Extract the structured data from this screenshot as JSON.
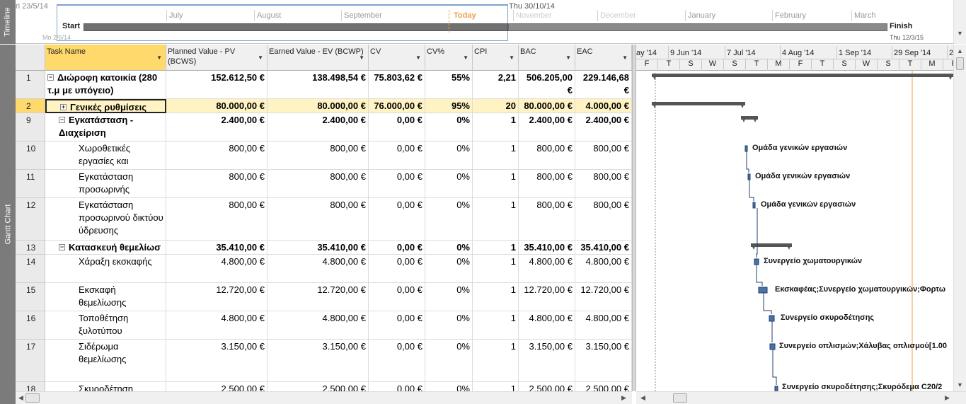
{
  "timeline": {
    "side_label": "Timeline",
    "start_date_top": "ri 23/5/14",
    "start_date_bottom": "Mo 2/6/14",
    "end_window_date": "Thu 30/10/14",
    "finish_date": "Thu 12/3/15",
    "start_label": "Start",
    "finish_label": "Finish",
    "today_label": "Today",
    "months": [
      "July",
      "August",
      "September",
      "November",
      "December",
      "January",
      "February",
      "March"
    ]
  },
  "gantt_label": "Gantt Chart",
  "columns": [
    {
      "label": "Task Name"
    },
    {
      "label": "Planned Value - PV (BCWS)"
    },
    {
      "label": "Earned Value - EV (BCWP)"
    },
    {
      "label": "CV"
    },
    {
      "label": "CV%"
    },
    {
      "label": "CPI"
    },
    {
      "label": "BAC"
    },
    {
      "label": "EAC"
    }
  ],
  "rows": [
    {
      "id": "1",
      "name": "Διώροφη κατοικία (280 τ.μ με υπόγειο)",
      "pv": "152.612,50 €",
      "ev": "138.498,54 €",
      "cv": "75.803,62 €",
      "cvp": "55%",
      "cpi": "2,21",
      "bac": "506.205,00 €",
      "eac": "229.146,68 €"
    },
    {
      "id": "2",
      "name": "Γενικές ρυθμίσεις",
      "pv": "80.000,00 €",
      "ev": "80.000,00 €",
      "cv": "76.000,00 €",
      "cvp": "95%",
      "cpi": "20",
      "bac": "80.000,00 €",
      "eac": "4.000,00 €"
    },
    {
      "id": "9",
      "name": "Εγκατάσταση - Διαχείριση",
      "pv": "2.400,00 €",
      "ev": "2.400,00 €",
      "cv": "0,00 €",
      "cvp": "0%",
      "cpi": "1",
      "bac": "2.400,00 €",
      "eac": "2.400,00 €"
    },
    {
      "id": "10",
      "name": "Χωροθετικές εργασίες και",
      "pv": "800,00 €",
      "ev": "800,00 €",
      "cv": "0,00 €",
      "cvp": "0%",
      "cpi": "1",
      "bac": "800,00 €",
      "eac": "800,00 €"
    },
    {
      "id": "11",
      "name": "Εγκατάσταση προσωρινής",
      "pv": "800,00 €",
      "ev": "800,00 €",
      "cv": "0,00 €",
      "cvp": "0%",
      "cpi": "1",
      "bac": "800,00 €",
      "eac": "800,00 €"
    },
    {
      "id": "12",
      "name": "Εγκατάσταση προσωρινού δικτύου ύδρευσης",
      "pv": "800,00 €",
      "ev": "800,00 €",
      "cv": "0,00 €",
      "cvp": "0%",
      "cpi": "1",
      "bac": "800,00 €",
      "eac": "800,00 €"
    },
    {
      "id": "13",
      "name": "Κατασκευή θεμελίωσ",
      "pv": "35.410,00 €",
      "ev": "35.410,00 €",
      "cv": "0,00 €",
      "cvp": "0%",
      "cpi": "1",
      "bac": "35.410,00 €",
      "eac": "35.410,00 €"
    },
    {
      "id": "14",
      "name": "Χάραξη εκσκαφής",
      "pv": "4.800,00 €",
      "ev": "4.800,00 €",
      "cv": "0,00 €",
      "cvp": "0%",
      "cpi": "1",
      "bac": "4.800,00 €",
      "eac": "4.800,00 €"
    },
    {
      "id": "15",
      "name": "Εκσκαφή θεμελίωσης",
      "pv": "12.720,00 €",
      "ev": "12.720,00 €",
      "cv": "0,00 €",
      "cvp": "0%",
      "cpi": "1",
      "bac": "12.720,00 €",
      "eac": "12.720,00 €"
    },
    {
      "id": "16",
      "name": "Τοποθέτηση ξυλοτύπου",
      "pv": "4.800,00 €",
      "ev": "4.800,00 €",
      "cv": "0,00 €",
      "cvp": "0%",
      "cpi": "1",
      "bac": "4.800,00 €",
      "eac": "4.800,00 €"
    },
    {
      "id": "17",
      "name": "Σιδέρωμα θεμελίωσης",
      "pv": "3.150,00 €",
      "ev": "3.150,00 €",
      "cv": "0,00 €",
      "cvp": "0%",
      "cpi": "1",
      "bac": "3.150,00 €",
      "eac": "3.150,00 €"
    },
    {
      "id": "18",
      "name": "Σκυροδέτηση",
      "pv": "2.500,00 €",
      "ev": "2.500,00 €",
      "cv": "0,00 €",
      "cvp": "0%",
      "cpi": "1",
      "bac": "2.500,00 €",
      "eac": "2.500,00 €"
    }
  ],
  "chart": {
    "weeks": [
      "ay '14",
      "9 Jun '14",
      "7 Jul '14",
      "4 Aug '14",
      "1 Sep '14",
      "29 Sep '14",
      "2"
    ],
    "days": [
      "F",
      "T",
      "S",
      "W",
      "S",
      "T",
      "M",
      "F",
      "T",
      "S",
      "W",
      "S",
      "T",
      "M",
      "F"
    ],
    "resources": [
      "Ομάδα γενικών εργασιών",
      "Ομάδα γενικών εργασιών",
      "Ομάδα γενικών εργασιών",
      "Συνεργείο χωματουργικών",
      "Εκσκαφέας;Συνεργείο χωματουργικών;Φορτω",
      "Συνεργείο σκυροδέτησης",
      "Συνεργείο οπλισμών;Χάλυβας οπλισμού[1.00",
      "Συνεργείο σκυροδέτησης;Σκυρόδεμα C20/2"
    ]
  }
}
